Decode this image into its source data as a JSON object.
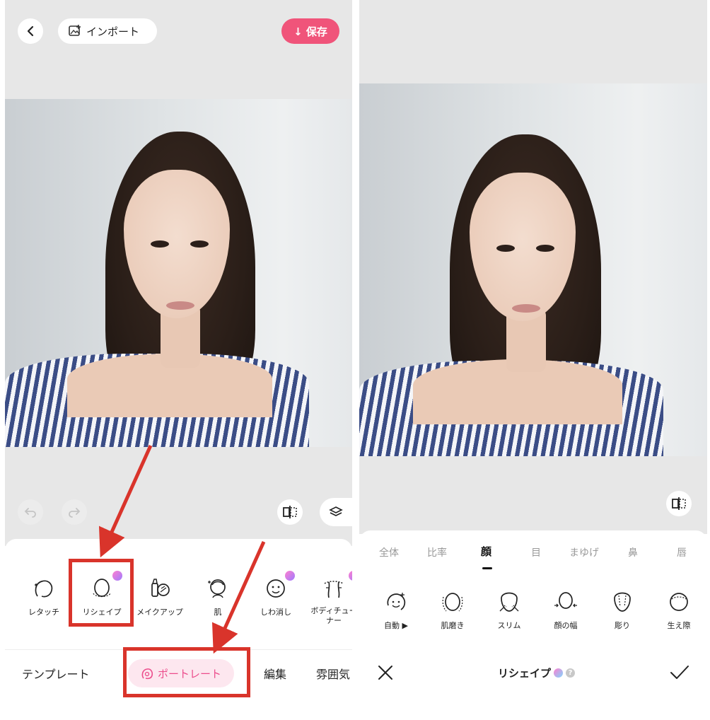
{
  "left": {
    "back_icon": "chevron-left-icon",
    "import_label": "インポート",
    "save_label": "↓ 保存",
    "save_color": "#f0547a",
    "tools": [
      {
        "id": "retouch",
        "label": "レタッチ",
        "icon": "face-retouch-icon",
        "premium": false
      },
      {
        "id": "reshape",
        "label": "リシェイプ",
        "icon": "face-reshape-icon",
        "premium": true
      },
      {
        "id": "makeup",
        "label": "メイクアップ",
        "icon": "makeup-icon",
        "premium": false
      },
      {
        "id": "skin",
        "label": "肌",
        "icon": "skin-icon",
        "premium": false
      },
      {
        "id": "wrinkle",
        "label": "しわ消し",
        "icon": "wrinkle-icon",
        "premium": true
      },
      {
        "id": "body",
        "label": "ボディチューナー",
        "icon": "body-tune-icon",
        "premium": true
      }
    ],
    "tabs": [
      {
        "label": "テンプレート",
        "active": false
      },
      {
        "label": "ポートレート",
        "active": true
      },
      {
        "label": "編集",
        "active": false
      },
      {
        "label": "雰囲気",
        "active": false
      }
    ]
  },
  "right": {
    "categories": [
      {
        "label": "全体",
        "active": false
      },
      {
        "label": "比率",
        "active": false
      },
      {
        "label": "顔",
        "active": true
      },
      {
        "label": "目",
        "active": false
      },
      {
        "label": "まゆげ",
        "active": false
      },
      {
        "label": "鼻",
        "active": false
      },
      {
        "label": "唇",
        "active": false
      }
    ],
    "tools": [
      {
        "label": "自動 ▶",
        "icon": "auto-face-icon"
      },
      {
        "label": "肌磨き",
        "icon": "face-smooth-icon"
      },
      {
        "label": "スリム",
        "icon": "face-slim-icon"
      },
      {
        "label": "顔の幅",
        "icon": "face-width-icon"
      },
      {
        "label": "彫り",
        "icon": "face-contour-icon"
      },
      {
        "label": "生え際",
        "icon": "hairline-icon"
      }
    ],
    "title": "リシェイプ",
    "cancel_icon": "close-icon",
    "confirm_icon": "check-icon"
  },
  "colors": {
    "accent_pink": "#f0547a",
    "highlight_red": "#d9342b",
    "active_tab_bg": "#fde7ef",
    "active_tab_text": "#ec4d8c"
  }
}
